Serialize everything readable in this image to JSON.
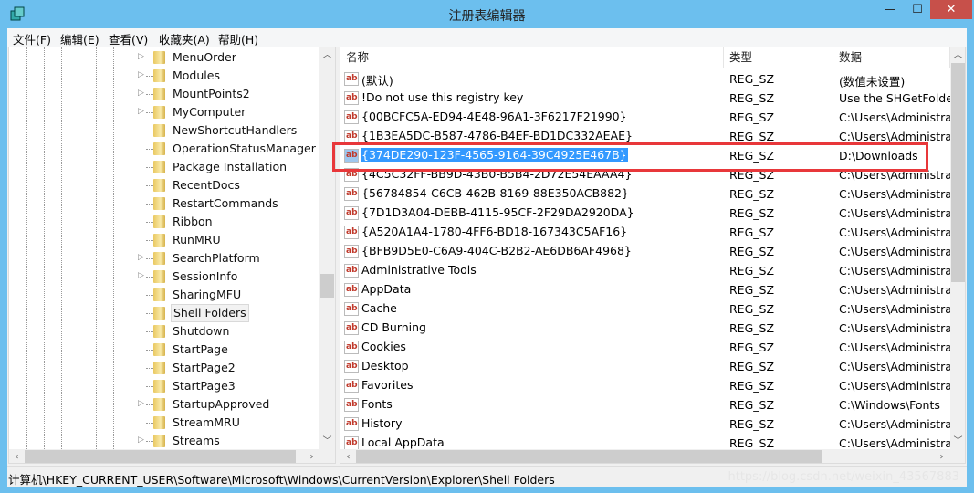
{
  "window": {
    "title": "注册表编辑器",
    "app_icon": "regedit-icon",
    "minimize": "—",
    "maximize": "☐",
    "close": "✕"
  },
  "menu": [
    {
      "label": "文件(F)"
    },
    {
      "label": "编辑(E)"
    },
    {
      "label": "查看(V)"
    },
    {
      "label": "收藏夹(A)"
    },
    {
      "label": "帮助(H)"
    }
  ],
  "tree": {
    "selected": "Shell Folders",
    "items": [
      {
        "label": "MenuOrder",
        "expandable": true
      },
      {
        "label": "Modules",
        "expandable": true
      },
      {
        "label": "MountPoints2",
        "expandable": true
      },
      {
        "label": "MyComputer",
        "expandable": true
      },
      {
        "label": "NewShortcutHandlers",
        "expandable": false
      },
      {
        "label": "OperationStatusManager",
        "expandable": false
      },
      {
        "label": "Package Installation",
        "expandable": false
      },
      {
        "label": "RecentDocs",
        "expandable": false
      },
      {
        "label": "RestartCommands",
        "expandable": false
      },
      {
        "label": "Ribbon",
        "expandable": false
      },
      {
        "label": "RunMRU",
        "expandable": false
      },
      {
        "label": "SearchPlatform",
        "expandable": true
      },
      {
        "label": "SessionInfo",
        "expandable": true
      },
      {
        "label": "SharingMFU",
        "expandable": false
      },
      {
        "label": "Shell Folders",
        "expandable": false
      },
      {
        "label": "Shutdown",
        "expandable": false
      },
      {
        "label": "StartPage",
        "expandable": false
      },
      {
        "label": "StartPage2",
        "expandable": false
      },
      {
        "label": "StartPage3",
        "expandable": false
      },
      {
        "label": "StartupApproved",
        "expandable": true
      },
      {
        "label": "StreamMRU",
        "expandable": false
      },
      {
        "label": "Streams",
        "expandable": true
      }
    ]
  },
  "list": {
    "columns": [
      "名称",
      "类型",
      "数据"
    ],
    "selected_index": 4,
    "value_icon": "ab",
    "rows": [
      {
        "name": "(默认)",
        "type": "REG_SZ",
        "data": "(数值未设置)"
      },
      {
        "name": "!Do not use this registry key",
        "type": "REG_SZ",
        "data": "Use the SHGetFolderPath"
      },
      {
        "name": "{00BCFC5A-ED94-4E48-96A1-3F6217F21990}",
        "type": "REG_SZ",
        "data": "C:\\Users\\Administrator"
      },
      {
        "name": "{1B3EA5DC-B587-4786-B4EF-BD1DC332AEAE}",
        "type": "REG_SZ",
        "data": "C:\\Users\\Administrator"
      },
      {
        "name": "{374DE290-123F-4565-9164-39C4925E467B}",
        "type": "REG_SZ",
        "data": "D:\\Downloads"
      },
      {
        "name": "{4C5C32FF-BB9D-43B0-B5B4-2D72E54EAAA4}",
        "type": "REG_SZ",
        "data": "C:\\Users\\Administrator"
      },
      {
        "name": "{56784854-C6CB-462B-8169-88E350ACB882}",
        "type": "REG_SZ",
        "data": "C:\\Users\\Administrator"
      },
      {
        "name": "{7D1D3A04-DEBB-4115-95CF-2F29DA2920DA}",
        "type": "REG_SZ",
        "data": "C:\\Users\\Administrator"
      },
      {
        "name": "{A520A1A4-1780-4FF6-BD18-167343C5AF16}",
        "type": "REG_SZ",
        "data": "C:\\Users\\Administrator"
      },
      {
        "name": "{BFB9D5E0-C6A9-404C-B2B2-AE6DB6AF4968}",
        "type": "REG_SZ",
        "data": "C:\\Users\\Administrator"
      },
      {
        "name": "Administrative Tools",
        "type": "REG_SZ",
        "data": "C:\\Users\\Administrator"
      },
      {
        "name": "AppData",
        "type": "REG_SZ",
        "data": "C:\\Users\\Administrator"
      },
      {
        "name": "Cache",
        "type": "REG_SZ",
        "data": "C:\\Users\\Administrator"
      },
      {
        "name": "CD Burning",
        "type": "REG_SZ",
        "data": "C:\\Users\\Administrator"
      },
      {
        "name": "Cookies",
        "type": "REG_SZ",
        "data": "C:\\Users\\Administrator"
      },
      {
        "name": "Desktop",
        "type": "REG_SZ",
        "data": "C:\\Users\\Administrator"
      },
      {
        "name": "Favorites",
        "type": "REG_SZ",
        "data": "C:\\Users\\Administrator"
      },
      {
        "name": "Fonts",
        "type": "REG_SZ",
        "data": "C:\\Windows\\Fonts"
      },
      {
        "name": "History",
        "type": "REG_SZ",
        "data": "C:\\Users\\Administrator"
      },
      {
        "name": "Local AppData",
        "type": "REG_SZ",
        "data": "C:\\Users\\Administrator"
      }
    ]
  },
  "status": {
    "path": "计算机\\HKEY_CURRENT_USER\\Software\\Microsoft\\Windows\\CurrentVersion\\Explorer\\Shell Folders",
    "watermark": "https://blog.csdn.net/weixin_43567883"
  },
  "colors": {
    "titlebar": "#6cbfee",
    "selection": "#3399ff",
    "highlight_box": "#e8373a"
  }
}
